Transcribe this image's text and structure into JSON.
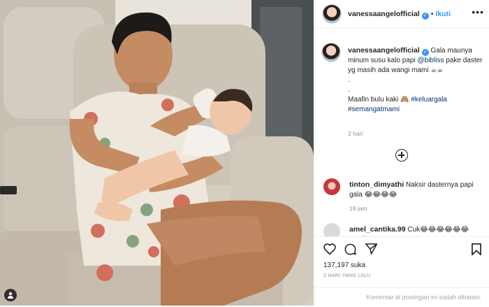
{
  "post": {
    "username": "vanessaangelofficial",
    "verified_mark": "✓",
    "separator": "•",
    "follow_label": "Ikuti",
    "more_label": "•••"
  },
  "caption": {
    "username": "vanessaangelofficial",
    "line1": "Gala maunya minum susu kalo papi",
    "mention": "@bibliss",
    "line2": "pake daster yg masih ada wangi mami ☕☕",
    "dot1": ".",
    "dot2": ".",
    "line3": "Maafin bulu kaki 🙈",
    "hashtag1": "#keluargala",
    "hashtag2": "#semangatmami",
    "time": "2 hari"
  },
  "comments": [
    {
      "username": "tinton_dimyathi",
      "text": "Naksir dasternya papi gala 😂😂😂😂",
      "time": "19 jam"
    },
    {
      "username": "amel_cantika.99",
      "text": "Cuk😂😂😂😂😂😂masih"
    }
  ],
  "stats": {
    "likes": "137,197 suka",
    "date": "2 HARI YANG LALU"
  },
  "footer": {
    "comments_disabled": "Komentar di postingan ini sudah dibatasi."
  },
  "icons": {
    "like": "heart-icon",
    "comment": "comment-icon",
    "share": "share-icon",
    "save": "bookmark-icon",
    "load_more": "plus-circle-icon",
    "tag_people": "user-tag-icon"
  },
  "colors": {
    "link": "#3897f0",
    "text": "#262626",
    "muted": "#8e8e8e",
    "mention": "#00376b"
  }
}
